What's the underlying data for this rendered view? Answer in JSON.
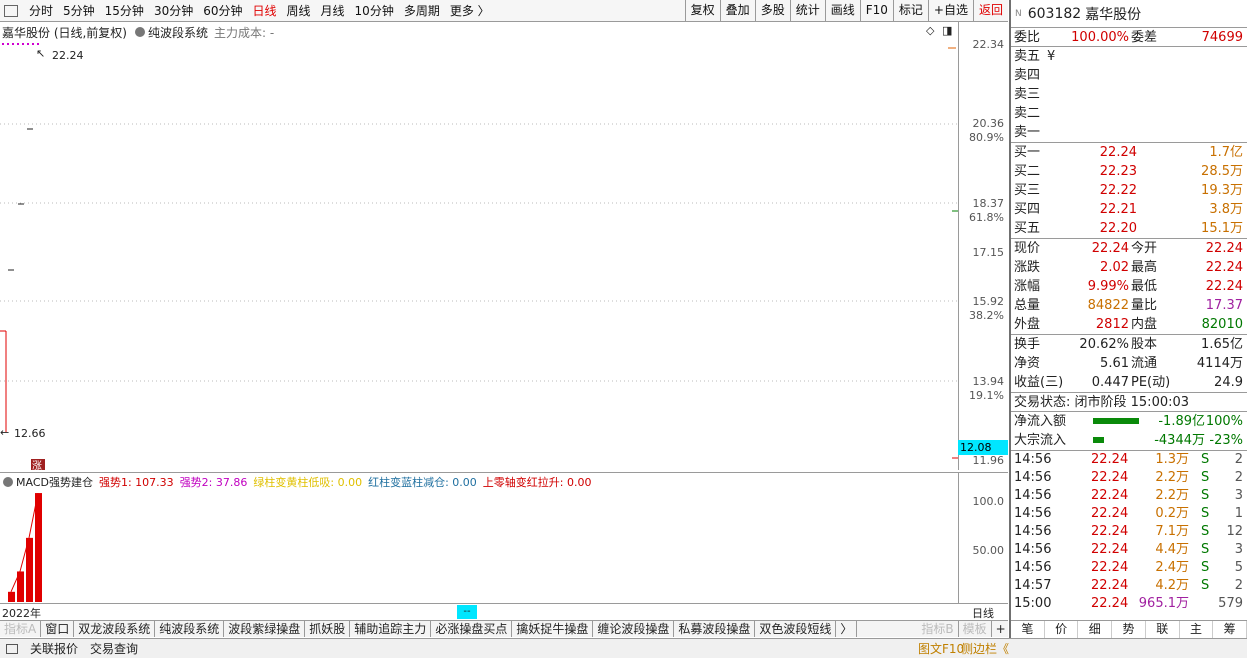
{
  "period_tabs": [
    "分时",
    "5分钟",
    "15分钟",
    "30分钟",
    "60分钟",
    "日线",
    "周线",
    "月线",
    "10分钟",
    "多周期",
    "更多 〉"
  ],
  "active_period": "日线",
  "right_tools": [
    "复权",
    "叠加",
    "多股",
    "统计",
    "画线",
    "F10",
    "标记",
    "+自选",
    "返回"
  ],
  "chart_title": {
    "stock": "嘉华股份 (日线,前复权)",
    "system": "纯波段系统",
    "cost": "主力成本: -"
  },
  "price_axis": [
    "22.34",
    "20.36",
    "80.9%",
    "18.37",
    "61.8%",
    "17.15",
    "15.92",
    "38.2%",
    "13.94",
    "19.1%",
    "11.96"
  ],
  "annotations": {
    "high": "22.24",
    "low": "12.66",
    "zhang": "涨"
  },
  "current_price_box": "12.08",
  "macd": {
    "name": "MACD强势建仓",
    "s1": "强势1: 107.33",
    "s2": "强势2: 37.86",
    "s3": "绿柱变黄柱低吸: 0.00",
    "s4": "红柱变蓝柱减仓: 0.00",
    "s5": "上零轴变红拉升: 0.00",
    "axis": [
      "100.0",
      "50.00"
    ],
    "bars": [
      10,
      30,
      63,
      107
    ]
  },
  "date_row": {
    "year": "2022年",
    "cursor": "--",
    "day": "日线"
  },
  "indicator_tabs": [
    "指标A",
    "窗口",
    "双龙波段系统",
    "纯波段系统",
    "波段紫绿操盘",
    "抓妖股",
    "辅助追踪主力",
    "必涨操盘买点",
    "擒妖捉牛操盘",
    "缠论波段操盘",
    "私募波段操盘",
    "双色波段短线",
    "〉",
    "指标B",
    "模板",
    "+",
    "-"
  ],
  "status": {
    "left1": "关联报价",
    "left2": "交易查询",
    "right1": "图文F10",
    "right2": "侧边栏《"
  },
  "quote": {
    "code": "603182",
    "name": "嘉华股份",
    "weibi_label": "委比",
    "weibi": "100.00%",
    "weicha_label": "委差",
    "weicha": "74699",
    "sells": [
      {
        "label": "卖五",
        "price": "¥",
        "vol": ""
      },
      {
        "label": "卖四",
        "price": "",
        "vol": ""
      },
      {
        "label": "卖三",
        "price": "",
        "vol": ""
      },
      {
        "label": "卖二",
        "price": "",
        "vol": ""
      },
      {
        "label": "卖一",
        "price": "",
        "vol": ""
      }
    ],
    "buys": [
      {
        "label": "买一",
        "price": "22.24",
        "vol": "1.7亿"
      },
      {
        "label": "买二",
        "price": "22.23",
        "vol": "28.5万"
      },
      {
        "label": "买三",
        "price": "22.22",
        "vol": "19.3万"
      },
      {
        "label": "买四",
        "price": "22.21",
        "vol": "3.8万"
      },
      {
        "label": "买五",
        "price": "22.20",
        "vol": "15.1万"
      }
    ],
    "stats1": [
      {
        "l1": "现价",
        "v1": "22.24",
        "l2": "今开",
        "v2": "22.24"
      },
      {
        "l1": "涨跌",
        "v1": "2.02",
        "l2": "最高",
        "v2": "22.24"
      },
      {
        "l1": "涨幅",
        "v1": "9.99%",
        "l2": "最低",
        "v2": "22.24"
      },
      {
        "l1": "总量",
        "v1": "84822",
        "l2": "量比",
        "v2": "17.37"
      },
      {
        "l1": "外盘",
        "v1": "2812",
        "l2": "内盘",
        "v2": "82010"
      }
    ],
    "stats2": [
      {
        "l1": "换手",
        "v1": "20.62%",
        "l2": "股本",
        "v2": "1.65亿"
      },
      {
        "l1": "净资",
        "v1": "5.61",
        "l2": "流通",
        "v2": "4114万"
      },
      {
        "l1": "收益(三)",
        "v1": "0.447",
        "l2": "PE(动)",
        "v2": "24.9"
      }
    ],
    "trade_status": "交易状态: 闭市阶段 15:00:03",
    "flow": [
      {
        "label": "净流入额",
        "value": "-1.89亿",
        "pct": "100%",
        "bar": 1.0
      },
      {
        "label": "大宗流入",
        "value": "-4344万",
        "pct": "-23%",
        "bar": 0.23
      }
    ],
    "ticks": [
      {
        "t": "14:56",
        "p": "22.24",
        "v": "1.3万",
        "s": "S",
        "n": "2"
      },
      {
        "t": "14:56",
        "p": "22.24",
        "v": "2.2万",
        "s": "S",
        "n": "2"
      },
      {
        "t": "14:56",
        "p": "22.24",
        "v": "2.2万",
        "s": "S",
        "n": "3"
      },
      {
        "t": "14:56",
        "p": "22.24",
        "v": "0.2万",
        "s": "S",
        "n": "1"
      },
      {
        "t": "14:56",
        "p": "22.24",
        "v": "7.1万",
        "s": "S",
        "n": "12"
      },
      {
        "t": "14:56",
        "p": "22.24",
        "v": "4.4万",
        "s": "S",
        "n": "3"
      },
      {
        "t": "14:56",
        "p": "22.24",
        "v": "2.4万",
        "s": "S",
        "n": "5"
      },
      {
        "t": "14:57",
        "p": "22.24",
        "v": "4.2万",
        "s": "S",
        "n": "2"
      },
      {
        "t": "15:00",
        "p": "22.24",
        "v": "965.1万",
        "s": "",
        "n": "579"
      }
    ],
    "bottom_tabs": [
      "笔",
      "价",
      "细",
      "势",
      "联",
      "主",
      "筹"
    ]
  }
}
